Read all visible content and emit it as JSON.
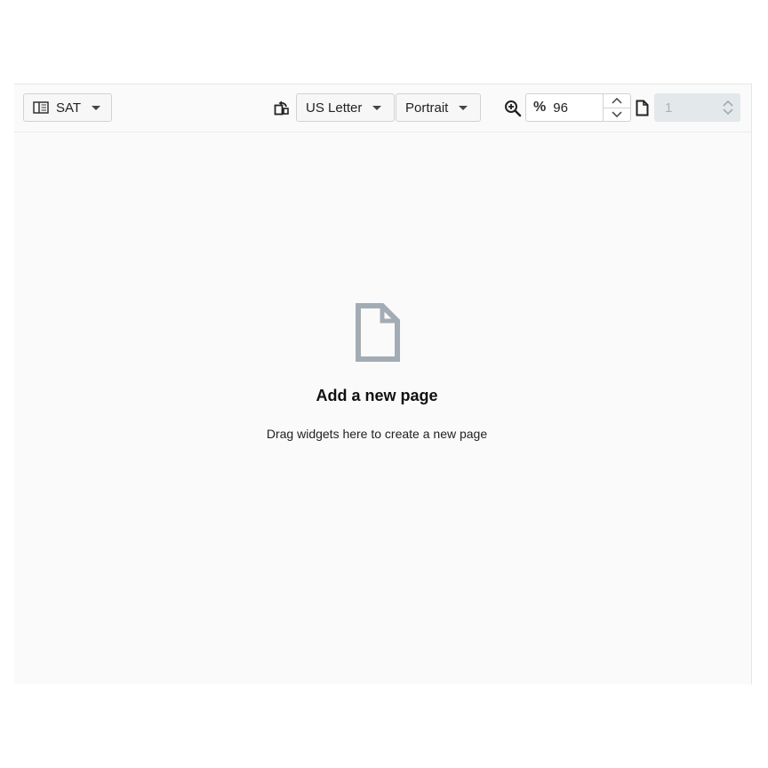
{
  "toolbar": {
    "layout_label": "SAT",
    "paper_size": "US Letter",
    "orientation": "Portrait",
    "zoom_symbol": "%",
    "zoom_value": "96",
    "page_value": "1"
  },
  "empty_state": {
    "title": "Add a new page",
    "subtitle": "Drag widgets here to create a new page"
  },
  "icons": {
    "layout": "layout-panel-icon",
    "orientation": "rotate-page-icon",
    "zoom": "zoom-in-icon",
    "page": "page-icon",
    "empty": "blank-document-icon"
  },
  "colors": {
    "canvas": "#fafafa",
    "icon_gray": "#a3acb4",
    "disabled_field": "#e3e8eb"
  }
}
